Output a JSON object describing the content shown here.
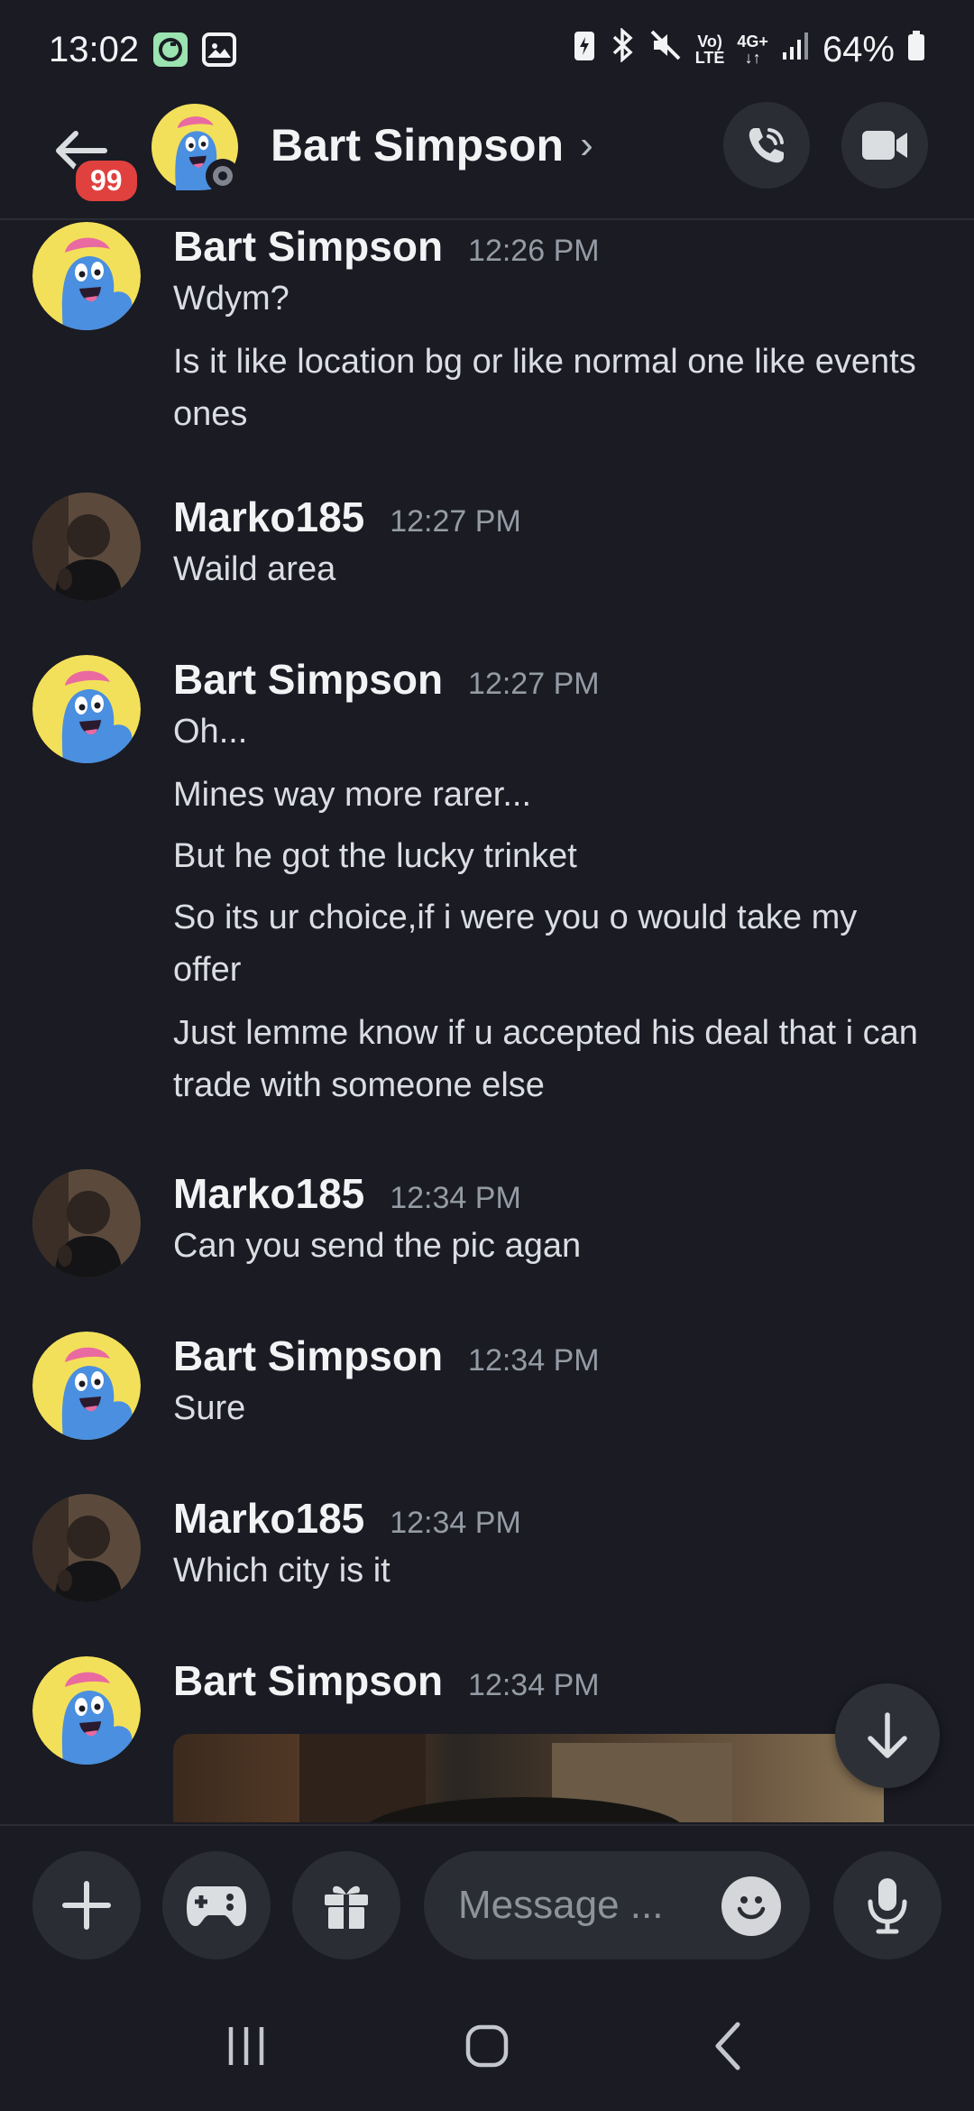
{
  "status_bar": {
    "time": "13:02",
    "network_top": "Vo)",
    "network_bottom": "LTE",
    "gen_top": "4G+",
    "gen_bottom": "↓↑",
    "battery": "64%"
  },
  "header": {
    "unread_badge": "99",
    "title": "Bart Simpson",
    "chevron": "›",
    "call_icon": "phone-call-icon",
    "video_icon": "video-camera-icon"
  },
  "messages": [
    {
      "author": "Bart Simpson",
      "time": "12:26 PM",
      "avatar": "blue-creature",
      "lines": [
        "Wdym?",
        "Is it like location bg or like normal one like events ones"
      ]
    },
    {
      "author": "Marko185",
      "time": "12:27 PM",
      "avatar": "photo",
      "lines": [
        "Waild area"
      ]
    },
    {
      "author": "Bart Simpson",
      "time": "12:27 PM",
      "avatar": "blue-creature",
      "lines": [
        "Oh...",
        "Mines way more rarer...",
        "But he got the lucky trinket",
        "So its ur choice,if i were you o would take my offer",
        "Just lemme know if u accepted his deal that i can trade with someone else"
      ]
    },
    {
      "author": "Marko185",
      "time": "12:34 PM",
      "avatar": "photo",
      "lines": [
        "Can you send the pic agan"
      ]
    },
    {
      "author": "Bart Simpson",
      "time": "12:34 PM",
      "avatar": "blue-creature",
      "lines": [
        "Sure"
      ]
    },
    {
      "author": "Marko185",
      "time": "12:34 PM",
      "avatar": "photo",
      "lines": [
        "Which city is it"
      ]
    },
    {
      "author": "Bart Simpson",
      "time": "12:34 PM",
      "avatar": "blue-creature",
      "lines": []
    }
  ],
  "composer": {
    "placeholder": "Message ...",
    "icons": [
      "plus-icon",
      "gamepad-icon",
      "gift-icon",
      "emoji-icon",
      "microphone-icon"
    ]
  },
  "colors": {
    "background": "#1a1b23",
    "surface": "#2b2d35",
    "badge": "#e0413e",
    "text_primary": "#f2f3f5",
    "text_secondary": "#949ba4"
  }
}
